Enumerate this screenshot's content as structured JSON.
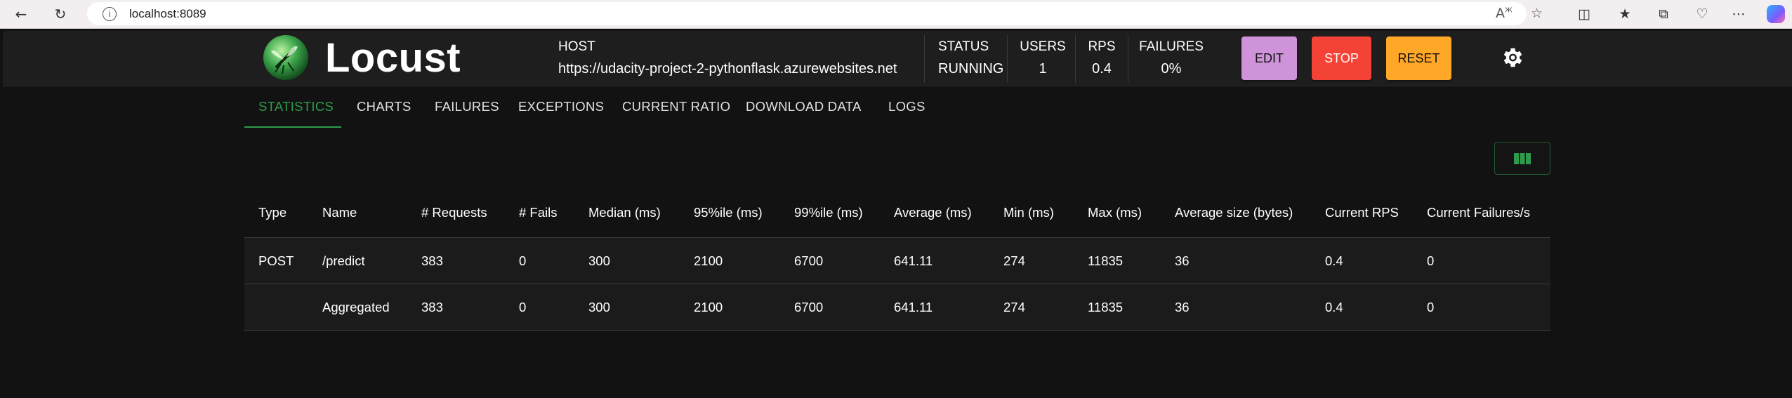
{
  "browser": {
    "url": "localhost:8089"
  },
  "app": {
    "name": "Locust",
    "host": {
      "label": "HOST",
      "value": "https://udacity-project-2-pythonflask.azurewebsites.net"
    },
    "status": {
      "label": "STATUS",
      "value": "RUNNING"
    },
    "users": {
      "label": "USERS",
      "value": "1"
    },
    "rps": {
      "label": "RPS",
      "value": "0.4"
    },
    "failures": {
      "label": "FAILURES",
      "value": "0%"
    },
    "buttons": {
      "edit": "EDIT",
      "stop": "STOP",
      "reset": "RESET"
    },
    "colors": {
      "edit": "#ce93d8",
      "stop": "#f44336",
      "reset": "#ffa726",
      "accent": "#2e9b4c"
    }
  },
  "tabs": [
    "STATISTICS",
    "CHARTS",
    "FAILURES",
    "EXCEPTIONS",
    "CURRENT RATIO",
    "DOWNLOAD DATA",
    "LOGS"
  ],
  "table": {
    "headers": [
      "Type",
      "Name",
      "# Requests",
      "# Fails",
      "Median (ms)",
      "95%ile (ms)",
      "99%ile (ms)",
      "Average (ms)",
      "Min (ms)",
      "Max (ms)",
      "Average size (bytes)",
      "Current RPS",
      "Current Failures/s"
    ],
    "rows": [
      [
        "POST",
        "/predict",
        "383",
        "0",
        "300",
        "2100",
        "6700",
        "641.11",
        "274",
        "11835",
        "36",
        "0.4",
        "0"
      ],
      [
        "",
        "Aggregated",
        "383",
        "0",
        "300",
        "2100",
        "6700",
        "641.11",
        "274",
        "11835",
        "36",
        "0.4",
        "0"
      ]
    ]
  },
  "icons": {
    "back": "back-arrow-icon",
    "refresh": "refresh-icon",
    "info": "info-icon",
    "read_aloud": "read-aloud-icon",
    "favorite": "star-icon",
    "theme": "gear-icon",
    "columns": "columns-icon"
  }
}
